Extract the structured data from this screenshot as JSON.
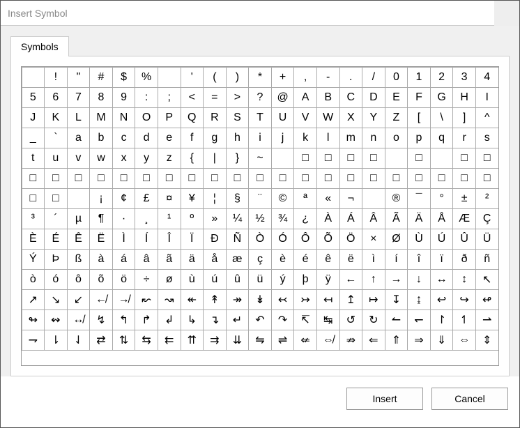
{
  "window": {
    "title": "Insert Symbol"
  },
  "tabs": {
    "symbols": "Symbols"
  },
  "buttons": {
    "insert": "Insert",
    "cancel": "Cancel"
  },
  "grid": {
    "columns": 21,
    "rows": [
      [
        " ",
        "!",
        "\"",
        "#",
        "$",
        "%",
        " ",
        "'",
        "(",
        ")",
        "*",
        "+",
        ",",
        "-",
        ".",
        "/",
        "0",
        "1",
        "2",
        "3",
        "4"
      ],
      [
        "5",
        "6",
        "7",
        "8",
        "9",
        ":",
        ";",
        "<",
        "=",
        ">",
        "?",
        "@",
        "A",
        "B",
        "C",
        "D",
        "E",
        "F",
        "G",
        "H",
        "I"
      ],
      [
        "J",
        "K",
        "L",
        "M",
        "N",
        "O",
        "P",
        "Q",
        "R",
        "S",
        "T",
        "U",
        "V",
        "W",
        "X",
        "Y",
        "Z",
        "[",
        "\\",
        "]",
        "^"
      ],
      [
        "_",
        "`",
        "a",
        "b",
        "c",
        "d",
        "e",
        "f",
        "g",
        "h",
        "i",
        "j",
        "k",
        "l",
        "m",
        "n",
        "o",
        "p",
        "q",
        "r",
        "s"
      ],
      [
        "t",
        "u",
        "v",
        "w",
        "x",
        "y",
        "z",
        "{",
        "|",
        "}",
        "~",
        " ",
        "□",
        "□",
        "□",
        "□",
        " ",
        "□",
        " ",
        "□",
        "□"
      ],
      [
        "□",
        "□",
        "□",
        "□",
        "□",
        "□",
        "□",
        "□",
        "□",
        "□",
        "□",
        "□",
        "□",
        "□",
        "□",
        "□",
        "□",
        "□",
        "□",
        "□",
        "□"
      ],
      [
        "□",
        "□",
        " ",
        "¡",
        "¢",
        "£",
        "¤",
        "¥",
        "¦",
        "§",
        "¨",
        "©",
        "ª",
        "«",
        "¬",
        " ",
        "®",
        "¯",
        "°",
        "±",
        "²"
      ],
      [
        "³",
        "´",
        "µ",
        "¶",
        "·",
        "¸",
        "¹",
        "º",
        "»",
        "¼",
        "½",
        "¾",
        "¿",
        "À",
        "Á",
        "Â",
        "Ã",
        "Ä",
        "Å",
        "Æ",
        "Ç"
      ],
      [
        "È",
        "É",
        "Ê",
        "Ë",
        "Ì",
        "Í",
        "Î",
        "Ï",
        "Ð",
        "Ñ",
        "Ò",
        "Ó",
        "Ô",
        "Õ",
        "Ö",
        "×",
        "Ø",
        "Ù",
        "Ú",
        "Û",
        "Ü"
      ],
      [
        "Ý",
        "Þ",
        "ß",
        "à",
        "á",
        "â",
        "ã",
        "ä",
        "å",
        "æ",
        "ç",
        "è",
        "é",
        "ê",
        "ë",
        "ì",
        "í",
        "î",
        "ï",
        "ð",
        "ñ"
      ],
      [
        "ò",
        "ó",
        "ô",
        "õ",
        "ö",
        "÷",
        "ø",
        "ù",
        "ú",
        "û",
        "ü",
        "ý",
        "þ",
        "ÿ",
        "←",
        "↑",
        "→",
        "↓",
        "↔",
        "↕",
        "↖"
      ],
      [
        "↗",
        "↘",
        "↙",
        "↚",
        "↛",
        "↜",
        "↝",
        "↞",
        "↟",
        "↠",
        "↡",
        "↢",
        "↣",
        "↤",
        "↥",
        "↦",
        "↧",
        "↨",
        "↩",
        "↪",
        "↫"
      ],
      [
        "↬",
        "↭",
        "↮",
        "↯",
        "↰",
        "↱",
        "↲",
        "↳",
        "↴",
        "↵",
        "↶",
        "↷",
        "↸",
        "↹",
        "↺",
        "↻",
        "↼",
        "↽",
        "↾",
        "↿",
        "⇀"
      ],
      [
        "⇁",
        "⇂",
        "⇃",
        "⇄",
        "⇅",
        "⇆",
        "⇇",
        "⇈",
        "⇉",
        "⇊",
        "⇋",
        "⇌",
        "⇍",
        "⇎",
        "⇏",
        "⇐",
        "⇑",
        "⇒",
        "⇓",
        "⇔",
        "⇕"
      ]
    ]
  }
}
